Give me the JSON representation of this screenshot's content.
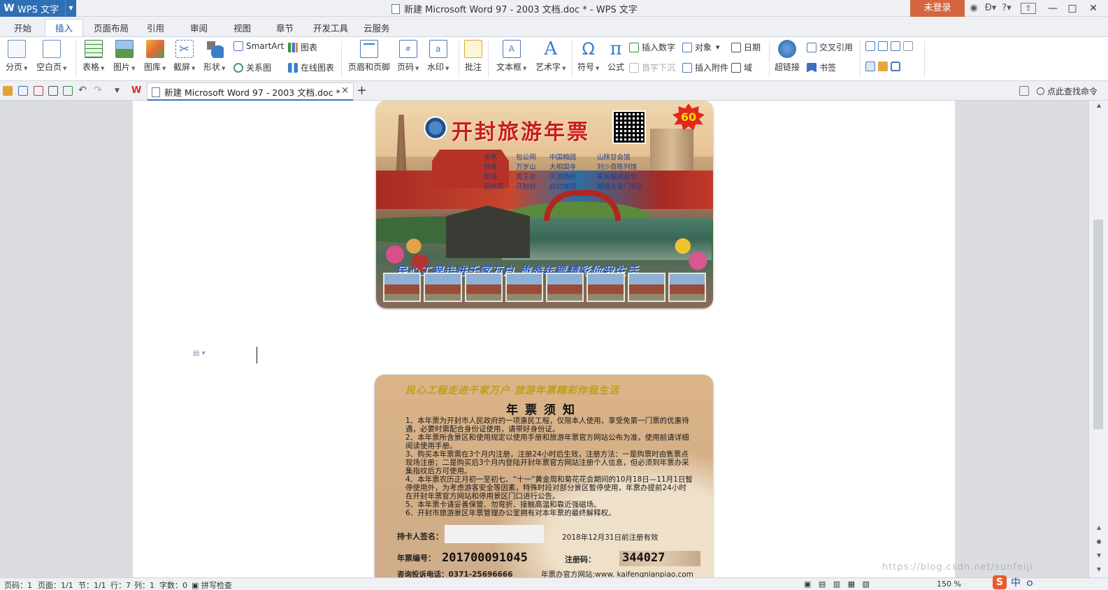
{
  "app": {
    "name": "WPS 文字",
    "window_title": "新建 Microsoft Word 97 - 2003 文档.doc * - WPS 文字",
    "login_label": "未登录"
  },
  "title_icons": [
    "shield-icon",
    "d-arrow-icon",
    "help-icon",
    "upload-icon"
  ],
  "help_label": "?",
  "tabs": [
    "开始",
    "插入",
    "页面布局",
    "引用",
    "审阅",
    "视图",
    "章节",
    "开发工具",
    "云服务"
  ],
  "active_tab": "插入",
  "ribbon": {
    "page_break": "分页",
    "blank_page": "空白页",
    "table": "表格",
    "picture": "图片",
    "gallery": "图库",
    "screenshot": "截屏",
    "shape": "形状",
    "smartart": "SmartArt",
    "chart": "图表",
    "relation": "关系图",
    "online_chart": "在线图表",
    "header_footer": "页眉和页脚",
    "page_number": "页码",
    "watermark": "水印",
    "comment": "批注",
    "textbox": "文本框",
    "wordart": "艺术字",
    "symbol": "符号",
    "formula": "公式",
    "insert_number": "插入数字",
    "object": "对象",
    "date": "日期",
    "drop_cap": "首字下沉",
    "attachment": "插入附件",
    "field": "域",
    "hyperlink": "超链接",
    "cross_ref": "交叉引用",
    "bookmark": "书签",
    "symbol_glyph": "Ω",
    "formula_glyph": "π",
    "wordart_glyph": "A"
  },
  "doc_tab": {
    "label": "新建 Microsoft Word 97 - 2003 文档.doc *",
    "close": "×",
    "new": "+"
  },
  "find_command": "点此查找命令",
  "front_card": {
    "title": "开封旅游年票",
    "badge": "60",
    "sites": [
      "龙亭",
      "包公祠",
      "中国翰园",
      "山陕甘会馆",
      "铁塔",
      "万岁山",
      "大相国寺",
      "刘少奇陈列馆",
      "繁塔",
      "禹王台",
      "天波杨府",
      "朱仙镇清真寺",
      "延庆观",
      "开封府",
      "启封故园",
      "城墙大梁门景区"
    ],
    "slogan": "民心工程走进千家万户    旅游年票精彩你我生活"
  },
  "back_card": {
    "slogan": "民心工程走进千家万户      旅游年票精彩你我生活",
    "heading": "年票须知",
    "rules": [
      "1、本年票为开封市人民政府的一项惠民工程，仅限本人使用，享受免第一门票的优惠待遇，必要时需配合身份证使用，请带好身份证。",
      "2、本年票所含景区和使用规定以使用手册和旅游年票官方网站公布为准，使用前请详细阅读使用手册。",
      "3、购买本年票需在3个月内注册，注册24小时后生效，注册方法：一是购票时由售票点现场注册；二是购买后3个月内登陆开封年票官方网站注册个人信息，但必须到年票办采集指纹后方可使用。",
      "4、本年票农历正月初一至初七、“十一”黄金周和菊花花会期间的10月18日—11月1日暂停使用外，为考虑游客安全等因素，特殊时段对部分景区暂停使用，年票办提前24小时在开封年票官方网站和停用景区门口进行公告。",
      "5、本年票卡请妥善保管、勿弯折、接触高温和靠近强磁场。",
      "6、开封市旅游景区年票管理办公室拥有对本年票的最终解释权。"
    ],
    "signature_label": "持卡人签名：",
    "valid_text": "2018年12月31日前注册有效",
    "number_label": "年票编号：",
    "number_value": "201700091045",
    "code_label": "注册码：",
    "code_value": "344027",
    "phone_text": "咨询投诉电话：0371-25696666",
    "website_text": "年票办官方网站:www. kaifengnianpiao.com"
  },
  "status": {
    "page": "页码：1",
    "pages": "页面：1/1",
    "section": "节：1/1",
    "row": "行：7",
    "col": "列：1",
    "words": "字数：0",
    "spell": "拼写检查",
    "zoom": "150 %"
  },
  "watermark": "https://blog.csdn.net/sunfeiji",
  "ime": {
    "badge": "S",
    "mode": "中",
    "punct": "ｏ"
  }
}
